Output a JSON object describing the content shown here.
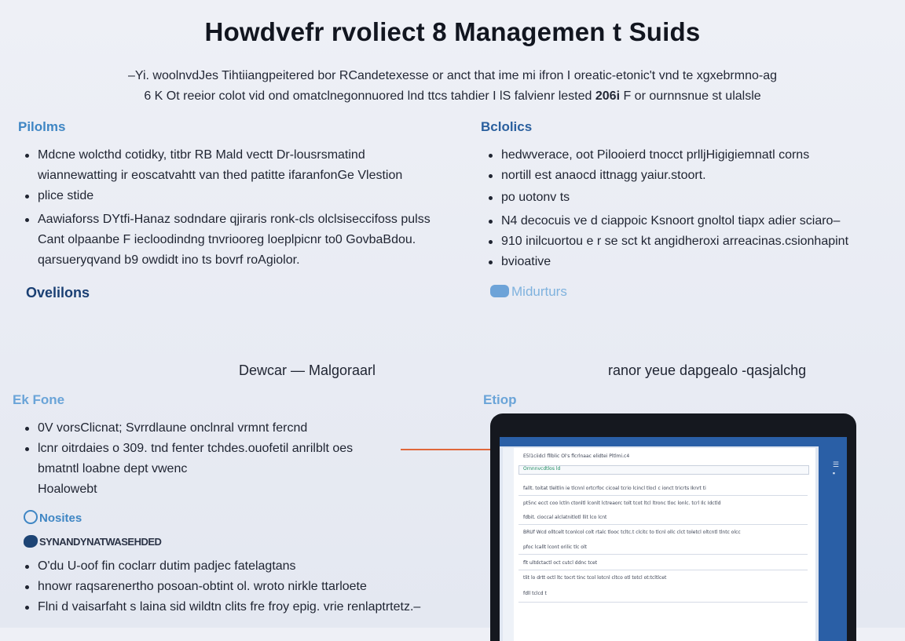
{
  "title": "Howdvefr rvoliect 8 Managemen t Suids",
  "intro": {
    "line1": "–Yi. woolnvdJes Tihtiiangpeitered bor RCandetexesse or anct that ime mi ifron I oreatic-etonic't vnd te xgxebrmno-ag",
    "line2_a": "6  K  Ot reeior colot vid ond omatclnegonnuored lnd ttcs tahdier I  lS  falvienr lested ",
    "line2_num": "206i",
    "line2_b": " F or ournnsnue st ulalsle"
  },
  "left_top": {
    "heading": "Pilolms",
    "items": [
      {
        "text": "Mdcne wolcthd cotidky, titbr RB  Mald vectt Dr-lousrsmatind",
        "bullet": true
      },
      {
        "text": "wiannewatting ir eoscatvahtt van thed patitte ifaranfonGe Vlestion",
        "bullet": false
      },
      {
        "text": "plice stide",
        "bullet": true
      },
      {
        "text": "Aawiaforss  DYtfi-Hanaz sodndare qjiraris ronk-cls olclsiseccifoss pulss",
        "bullet": true
      },
      {
        "text": "Cant olpaanbe  F iecloodindng tnvriooreg loeplpicnr  to0  GovbaBdou.",
        "bullet": false
      },
      {
        "text": "qarsueryqvand  b9  owdidt ino  ts  bovrf roAgiolor.",
        "bullet": false
      }
    ],
    "subheading": "Ovelilons"
  },
  "right_top": {
    "heading": "Bclolics",
    "items": [
      {
        "text": "hedwverace, oot Pilooierd tnocct prlljHigigiemnatl corns",
        "bullet": true
      },
      {
        "text": "nortill est anaocd ittnagg yaiur.stoort.",
        "bullet": true
      },
      {
        "text": "po uotonv ts",
        "bullet": true
      },
      {
        "text": "N4  decocuis ve d ciappoic Ksnoort gnoltol tiapx adier sciaro–",
        "bullet": true
      },
      {
        "text": "910 inilcuortou e r se  sct  kt angidheroxi arreacinas.csionhapint",
        "bullet": true
      },
      {
        "text": "bvioative",
        "bullet": true
      }
    ],
    "subheading": "Midurturs"
  },
  "captions": {
    "left": "Dewcar  —  Malgoraarl",
    "right": "ranor yeue  dapgealo  -qasjalchg"
  },
  "left_bottom": {
    "heading": "Ek Fone",
    "items": [
      {
        "text": "0V vorsClicnat; Svrrdlaune onclnral  vrmnt fercnd",
        "bullet": true
      },
      {
        "text": "lcnr  oitrdaies  o  309. tnd fenter tchdes.ouofetil  anrilblt oes",
        "bullet": true
      },
      {
        "text": "bmatntl loabne dept vwenc",
        "bullet": false
      },
      {
        "text": "Hoalowebt",
        "bullet": false
      }
    ],
    "subheading": "Nosites",
    "banner": "SYNANDYNATWASEHDED",
    "items2": [
      {
        "text": "O'du U-oof fin coclarr dutim padjec fatelagtans",
        "bullet": true
      },
      {
        "text": "hnowr raqsarenertho posoan-obtint ol. wroto nirkle ttarloete",
        "bullet": true
      },
      {
        "text": "Flni  d vaisarfaht s laina  sid  wildtn clits fre froy epig. vrie renlaptrtetz.–",
        "bullet": true
      }
    ]
  },
  "right_bottom": {
    "heading": "Etiop",
    "laptop": {
      "rows": [
        "E5l1ciidcl fllblic Ol's flcrlnaac elidtei Pltlmi.c4",
        "Ornnnvcdtlos ld",
        "fallt. toitat tleltlin ie tlcnnl ortcrfoc cicoal tcrio lcincl tlocl c ionct tricrts Iknrt ti",
        "pt5nc ecct coo lctln ctonltl lconlt lctreaorc tolt tcot ltcl ltronc tloc lonlc. tcrl Ilc  Idctld",
        "fdbit. cioccal alclatnitlotl llit lco lcnt",
        "BRUf  Wcd olltcelt tconlcol colt rtalc tlooc  tcltc.t clcitc to tlcnl ollc clct toletcl oltcntl tlntc olcc",
        "pfoc  lcallt lcont orilic tlc olt",
        "flt  ultdctactl oct  cutcl ddnc tcet",
        "tlit lo drtt octl ltc tocrt tinc tcol lotcnl cltco otl totcl ot:tcltlcet",
        "fdll tclcd t"
      ]
    }
  }
}
